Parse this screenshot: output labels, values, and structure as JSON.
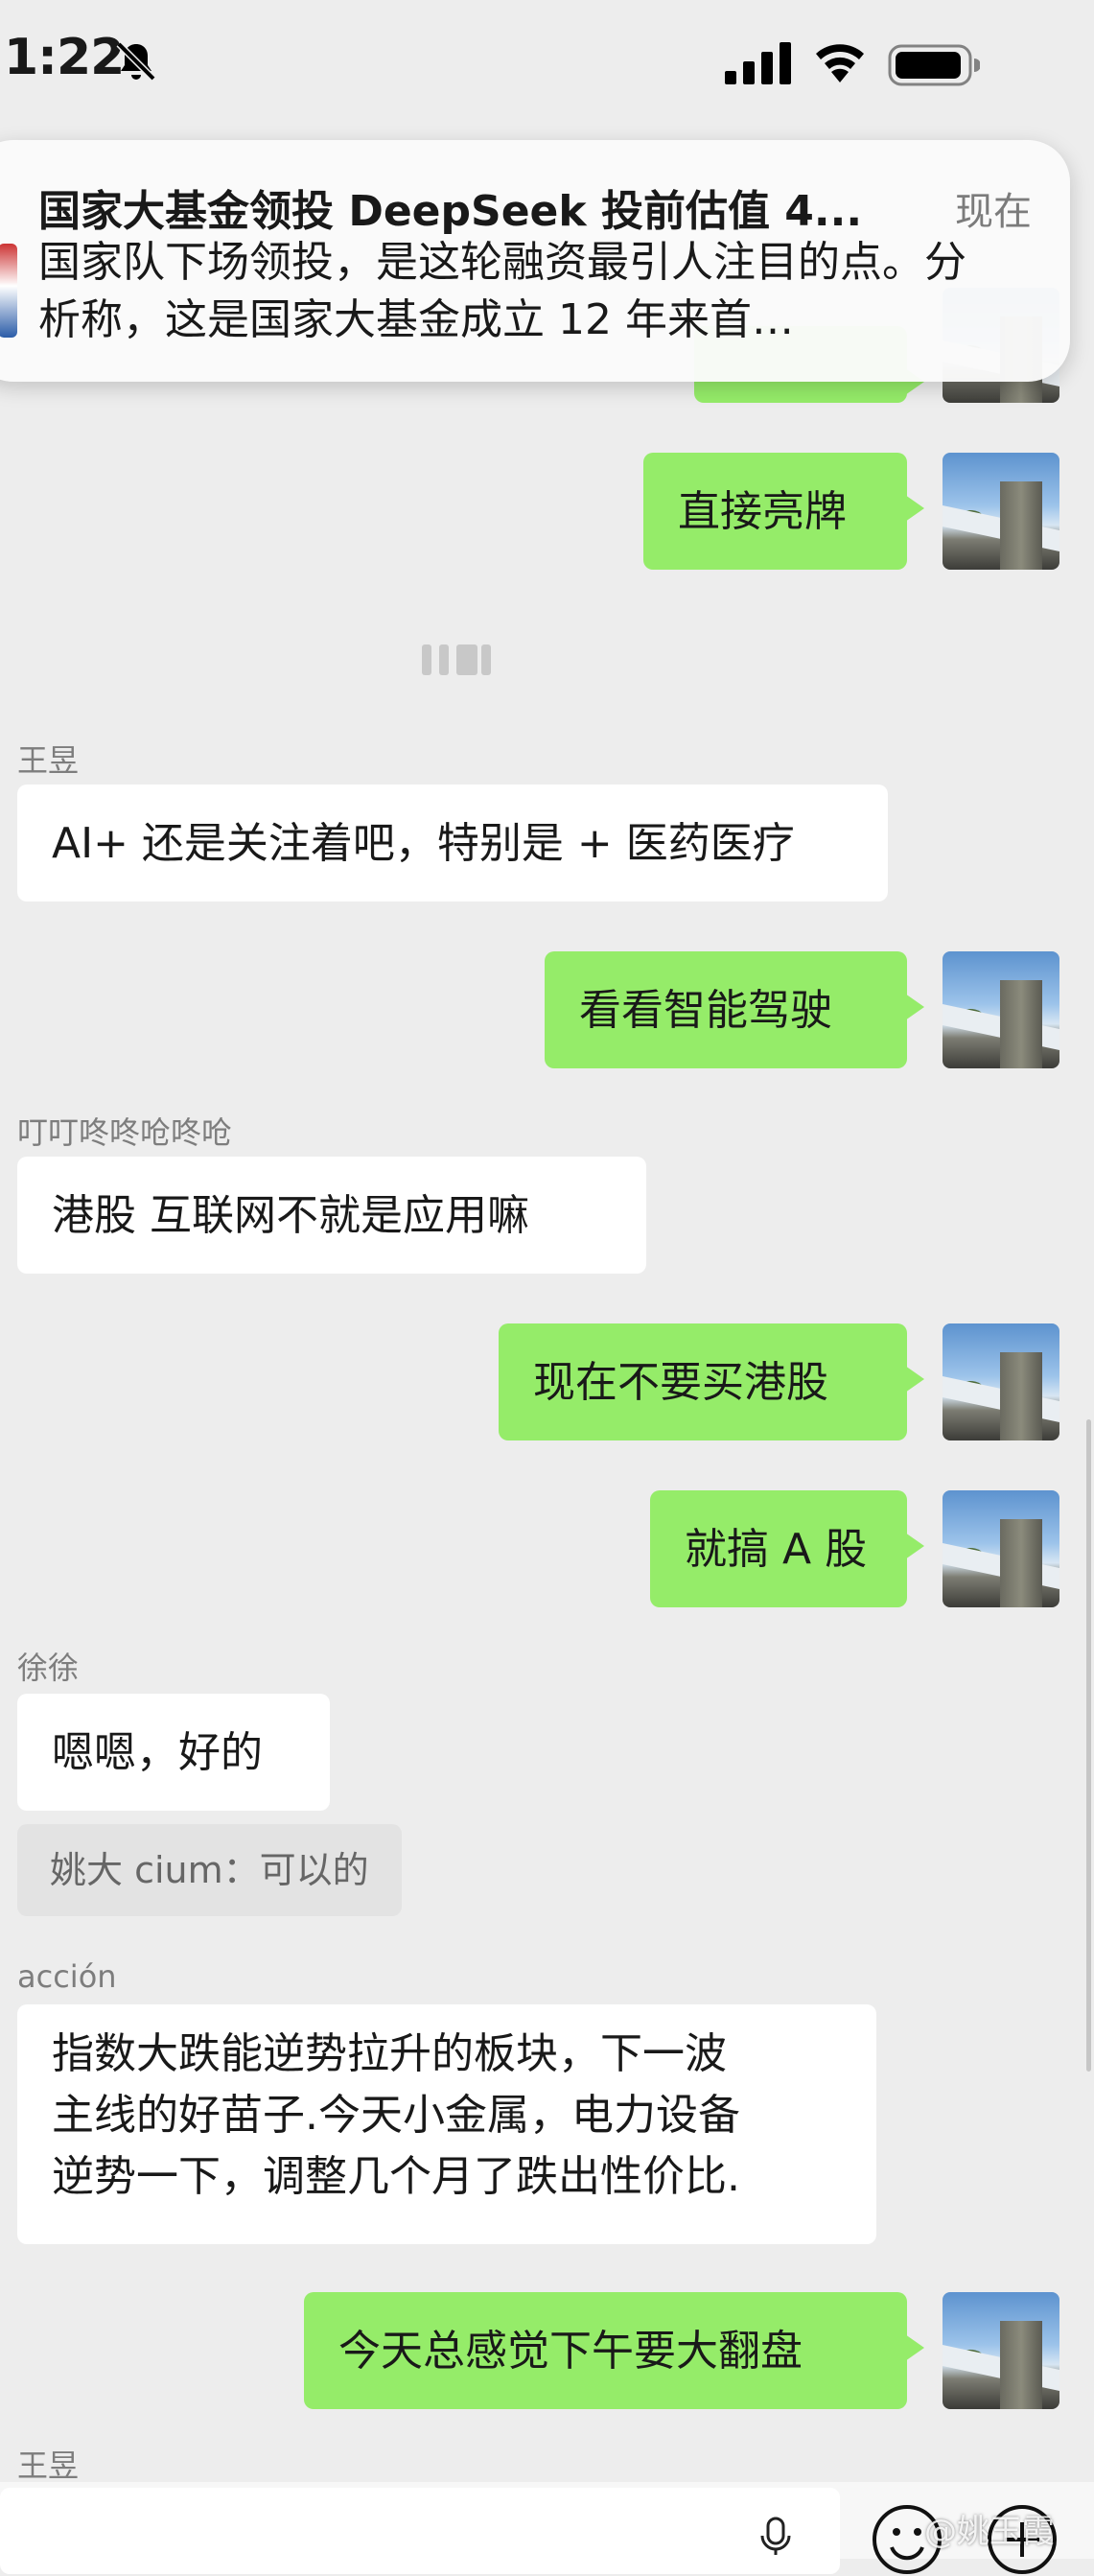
{
  "status_bar": {
    "time": "1:22",
    "icons": [
      "bell-off-icon",
      "cellular-signal-icon",
      "wifi-icon",
      "battery-icon"
    ]
  },
  "notification": {
    "title": "国家大基金领投 DeepSeek 投前估值 4...",
    "time": "现在",
    "body": "国家队下场领投，是这轮融资最引人注目的点。分析称，这是国家大基金成立 12 年来首…"
  },
  "messages": [
    {
      "side": "right",
      "text": "直接亮牌"
    },
    {
      "side": "left",
      "sender": "王昱",
      "text": "AI+ 还是关注着吧，特别是 + 医药医疗"
    },
    {
      "side": "right",
      "text": "看看智能驾驶"
    },
    {
      "side": "left",
      "sender": "叮叮咚咚呛咚呛",
      "text": "港股  互联网不就是应用嘛"
    },
    {
      "side": "right",
      "text": "现在不要买港股"
    },
    {
      "side": "right",
      "text": "就搞 A 股"
    },
    {
      "side": "left",
      "sender": "徐徐",
      "text": "嗯嗯，好的",
      "quote": "姚大 cium：可以的"
    },
    {
      "side": "left",
      "sender": "acción",
      "lines": [
        "指数大跌能逆势拉升的板块，下一波",
        "主线的好苗子.今天小金属，电力设备",
        "逆势一下，调整几个月了跌出性价比."
      ]
    },
    {
      "side": "right",
      "text": "今天总感觉下午要大翻盘"
    }
  ],
  "partial_sender": "王昱",
  "input_bar": {
    "icons": [
      "microphone-icon",
      "emoji-icon",
      "plus-icon"
    ]
  },
  "watermark": "@姚玉霞",
  "colors": {
    "background": "#ededed",
    "outgoing_bubble": "#95ec69",
    "incoming_bubble": "#ffffff",
    "sender_name": "#7d7d7d"
  }
}
